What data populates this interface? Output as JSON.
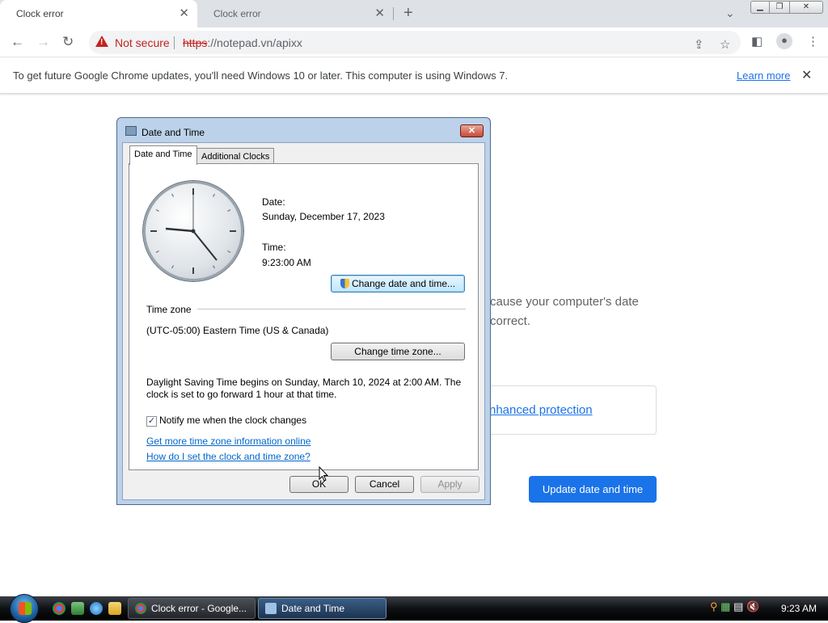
{
  "browser": {
    "tabs": [
      {
        "title": "Clock error",
        "active": true
      },
      {
        "title": "Clock error",
        "active": false
      }
    ],
    "new_tab": "+",
    "address": {
      "security": "Not secure",
      "scheme": "https",
      "rest": "://notepad.vn/apixx"
    },
    "infobar": {
      "message": "To get future Google Chrome updates, you'll need Windows 10 or later. This computer is using Windows 7.",
      "link": "Learn more"
    }
  },
  "page": {
    "text_line1": "cause your computer's date",
    "text_line2": "correct.",
    "protection_link": "nhanced protection",
    "update_button": "Update date and time"
  },
  "dialog": {
    "title": "Date and Time",
    "tabs": [
      "Date and Time",
      "Additional Clocks"
    ],
    "date_label": "Date:",
    "date_value": "Sunday, December 17, 2023",
    "time_label": "Time:",
    "time_value": "9:23:00 AM",
    "change_datetime_button": "Change date and time...",
    "timezone_heading": "Time zone",
    "timezone_value": "(UTC-05:00) Eastern Time (US & Canada)",
    "change_timezone_button": "Change time zone...",
    "dst_line1": "Daylight Saving Time begins on Sunday, March 10, 2024 at 2:00 AM. The",
    "dst_line2": "clock is set to go forward 1 hour at that time.",
    "notify_checkbox": "Notify me when the clock changes",
    "notify_checked": true,
    "link1": "Get more time zone information online",
    "link2": "How do I set the clock and time zone?",
    "ok": "OK",
    "cancel": "Cancel",
    "apply": "Apply"
  },
  "taskbar": {
    "tasks": [
      "Clock error - Google...",
      "Date and Time"
    ],
    "time": "9:23 AM"
  },
  "colors": {
    "chrome_blue": "#1a73e8",
    "warning_red": "#c5221f"
  }
}
